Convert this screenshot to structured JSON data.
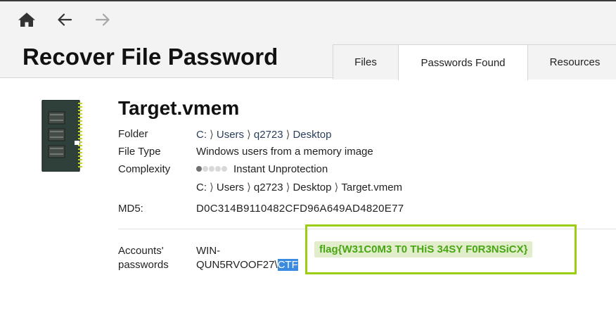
{
  "nav": {
    "home_icon": "home-icon",
    "back_icon": "arrow-left-icon",
    "forward_icon": "arrow-right-icon"
  },
  "header": {
    "title": "Recover File Password"
  },
  "tabs": [
    {
      "label": "Files",
      "active": false
    },
    {
      "label": "Passwords Found",
      "active": true
    },
    {
      "label": "Resources",
      "active": false
    }
  ],
  "file": {
    "icon": "memory-module-icon",
    "name": "Target.vmem",
    "folder_label": "Folder",
    "folder_path": [
      "C:",
      "Users",
      "q2723",
      "Desktop"
    ],
    "type_label": "File Type",
    "type_value": "Windows users from a memory image",
    "complexity_label": "Complexity",
    "complexity_level": 1,
    "complexity_max": 5,
    "complexity_value": "Instant Unprotection",
    "full_path": [
      "C:",
      "Users",
      "q2723",
      "Desktop",
      "Target.vmem"
    ],
    "md5_label": "MD5:",
    "md5_value": "D0C314B9110482CFD96A649AD4820E77"
  },
  "accounts": {
    "label_line1": "Accounts'",
    "label_line2": "passwords",
    "user_line1": "WIN-",
    "user_line2": "QUN5RVOOF27\\",
    "user_selected": "CTF",
    "password": "flag{W31C0M3 T0 THiS 34SY F0R3NSiCX}"
  },
  "colors": {
    "highlight_border": "#9acd14",
    "password_text": "#48a514",
    "password_bg": "#e2eecb",
    "selection": "#3b8be0",
    "breadcrumb": "#2a3e5c"
  }
}
